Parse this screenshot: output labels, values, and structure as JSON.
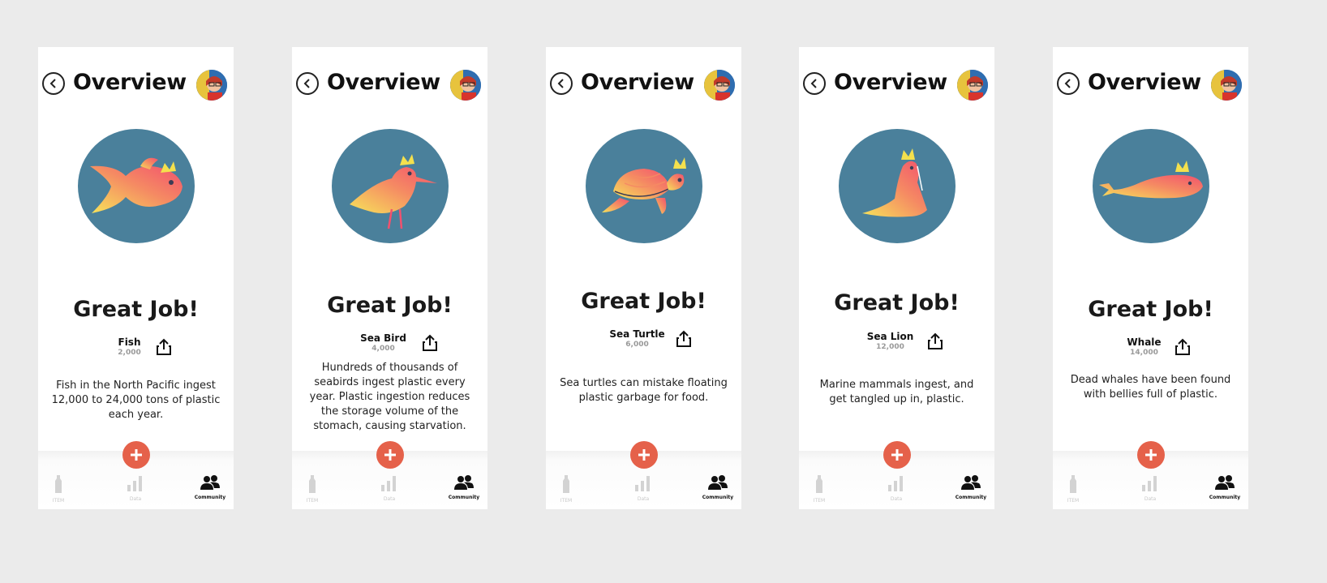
{
  "screens": [
    {
      "title": "Overview",
      "heading": "Great Job!",
      "animal": "Fish",
      "count": "2,000",
      "description": "Fish in the North Pacific ingest 12,000 to 24,000 tons of plastic each year.",
      "illustration_icon": "fish-icon",
      "tabs": [
        "ITEM",
        "Data",
        "Community"
      ]
    },
    {
      "title": "Overview",
      "heading": "Great Job!",
      "animal": "Sea Bird",
      "count": "4,000",
      "description": "Hundreds of thousands of seabirds ingest plastic every year. Plastic ingestion reduces the storage volume of the stomach, causing starvation.",
      "illustration_icon": "seabird-icon",
      "tabs": [
        "ITEM",
        "Data",
        "Community"
      ]
    },
    {
      "title": "Overview",
      "heading": "Great Job!",
      "animal": "Sea Turtle",
      "count": "6,000",
      "description": "Sea turtles can mistake floating plastic garbage for food.",
      "illustration_icon": "sea-turtle-icon",
      "tabs": [
        "ITEM",
        "Data",
        "Community"
      ]
    },
    {
      "title": "Overview",
      "heading": "Great Job!",
      "animal": "Sea Lion",
      "count": "12,000",
      "description": "Marine mammals ingest, and get tangled up in, plastic.",
      "illustration_icon": "sea-lion-icon",
      "tabs": [
        "ITEM",
        "Data",
        "Community"
      ]
    },
    {
      "title": "Overview",
      "heading": "Great Job!",
      "animal": "Whale",
      "count": "14,000",
      "description": "Dead whales have been found with bellies full of plastic.",
      "illustration_icon": "whale-icon",
      "tabs": [
        "ITEM",
        "Data",
        "Community"
      ]
    }
  ],
  "colors": {
    "background": "#ebebeb",
    "art_circle": "#4a809b",
    "accent_button": "#e5614a",
    "animal_gradient_start": "#f7e35a",
    "animal_gradient_end": "#f2516e",
    "crown": "#f4e04d",
    "tab_inactive": "#c8c8c8",
    "tab_active": "#111111"
  }
}
